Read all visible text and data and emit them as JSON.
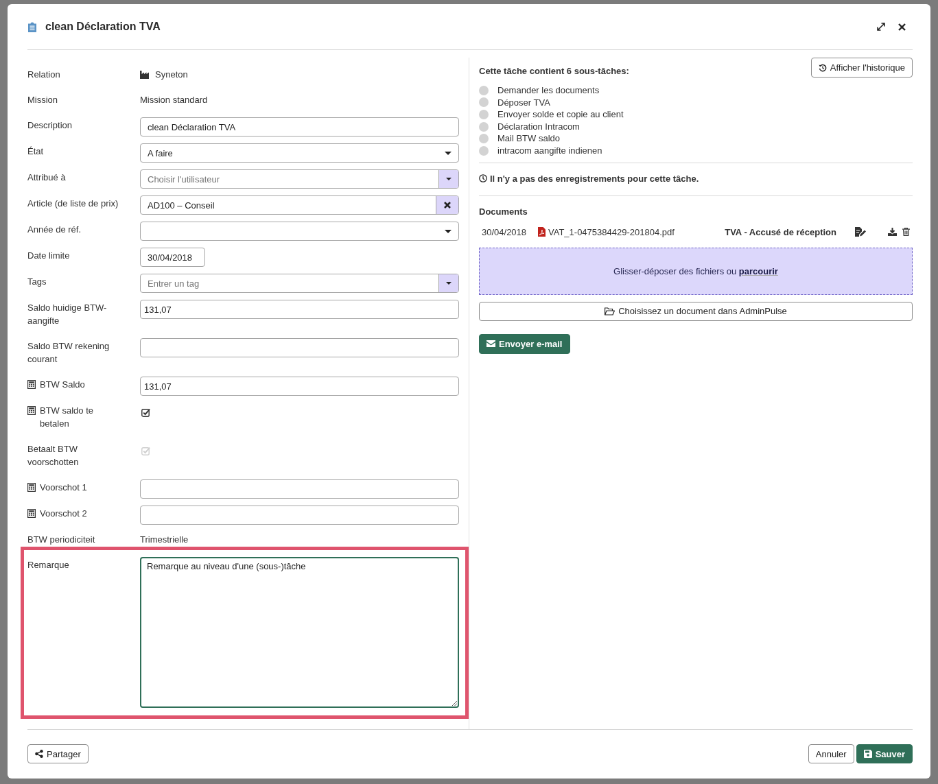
{
  "dialog": {
    "title": "clean Déclaration TVA"
  },
  "form": {
    "fields": [
      {
        "kind": "entity",
        "label": "Relation",
        "value": "Syneton",
        "calculated": false
      },
      {
        "kind": "static",
        "label": "Mission",
        "value": "Mission standard",
        "calculated": false
      },
      {
        "kind": "input",
        "label": "Description",
        "value": "clean Déclaration TVA",
        "calculated": false
      },
      {
        "kind": "select",
        "label": "État",
        "value": "A faire",
        "calculated": false
      },
      {
        "kind": "combo",
        "label": "Attribué à",
        "placeholder": "Choisir l'utilisateur",
        "calculated": false
      },
      {
        "kind": "clearable",
        "label": "Article (de liste de prix)",
        "value": "AD100 – Conseil",
        "calculated": false
      },
      {
        "kind": "select",
        "label": "Année de réf.",
        "calculated": false
      },
      {
        "kind": "date",
        "label": "Date limite",
        "value": "30/04/2018",
        "calculated": false
      },
      {
        "kind": "combo",
        "label": "Tags",
        "placeholder": "Entrer un tag",
        "calculated": false
      },
      {
        "kind": "number",
        "label": "Saldo huidige BTW-aangifte",
        "value": "131,07",
        "calculated": false
      },
      {
        "kind": "number",
        "label": "Saldo BTW rekening courant",
        "calculated": false
      },
      {
        "kind": "number",
        "label": "BTW Saldo",
        "value": "131,07",
        "calculated": true
      },
      {
        "kind": "checkbox",
        "label": "BTW saldo te betalen",
        "calculated": true,
        "checked": true,
        "disabled": false
      },
      {
        "kind": "checkbox",
        "label": "Betaalt BTW voorschotten",
        "calculated": false,
        "checked": true,
        "disabled": true
      },
      {
        "kind": "number",
        "label": "Voorschot 1",
        "calculated": true
      },
      {
        "kind": "number",
        "label": "Voorschot 2",
        "calculated": true
      },
      {
        "kind": "static",
        "label": "BTW periodiciteit",
        "value": "Trimestrielle",
        "calculated": false
      }
    ],
    "remark": {
      "label": "Remarque",
      "value": "Remarque au niveau d'une (sous-)tâche",
      "focused": true,
      "highlighted": true
    }
  },
  "tasks": {
    "heading": "Cette tâche contient 6 sous-tâches:",
    "history_button": "Afficher l'historique",
    "subtasks": [
      {
        "label": "Demander les documents",
        "done": false
      },
      {
        "label": "Déposer TVA",
        "done": false
      },
      {
        "label": "Envoyer solde et copie au client",
        "done": false
      },
      {
        "label": "Déclaration Intracom",
        "done": false
      },
      {
        "label": "Mail BTW saldo",
        "done": false
      },
      {
        "label": "intracom aangifte indienen",
        "done": false
      }
    ],
    "records_note": "Il n'y a pas des enregistrements pour cette tâche."
  },
  "documents": {
    "heading": "Documents",
    "files": [
      {
        "date": "30/04/2018",
        "name": "VAT_1-0475384429-201804.pdf",
        "description": "TVA - Accusé de réception"
      }
    ],
    "dropzone": {
      "text": "Glisser-déposer des fichiers ou",
      "link": "parcourir"
    },
    "pick_button": "Choisissez un document dans AdminPulse",
    "email_button": "Envoyer e-mail"
  },
  "footer": {
    "share_button": "Partager",
    "cancel_button": "Annuler",
    "save_button": "Sauver"
  }
}
